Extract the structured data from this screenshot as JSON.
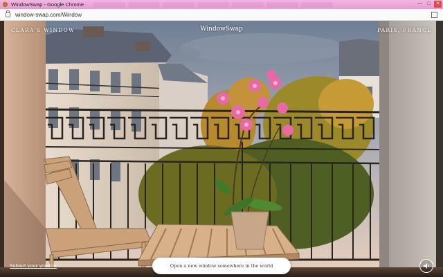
{
  "browser": {
    "window_title": "WindowSwap - Google Chrome",
    "url": "window-swap.com/Window",
    "icons": {
      "app": "chrome-icon",
      "lock": "lock-icon",
      "open_in_tab": "open-in-new-tab-icon",
      "minimize": "minimize-icon",
      "maximize": "maximize-icon",
      "close": "close-icon"
    },
    "title_bar_color": "#e89bd4"
  },
  "window_swap": {
    "brand": "WindowSwap",
    "owner_label": "CLARA'S WINDOW",
    "location_label": "PARIS, FRANCE",
    "submit_link": "Submit your window",
    "open_button_label": "Open a new window somewhere in the world",
    "sound_icon": "speaker-icon"
  }
}
